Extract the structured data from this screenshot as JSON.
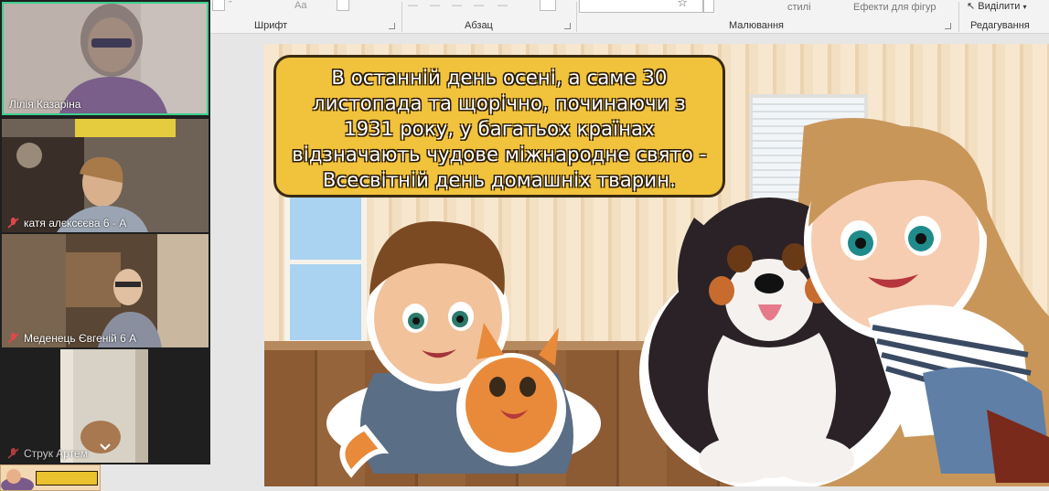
{
  "ribbon": {
    "groups": [
      {
        "label": "Шрифт"
      },
      {
        "label": "Абзац"
      },
      {
        "label": "Малювання"
      },
      {
        "label": "Редагування"
      }
    ],
    "top_items": {
      "styles": "стилі",
      "shape_effects": "Ефекти для фігур",
      "select": "Виділити"
    }
  },
  "slide": {
    "text": "В останній день осені, а саме 30 листопада та щорічно, починаючи з 1931 року, у багатьох країнах відзначають чудове міжнародне свято - Всесвітній день домашніх тварин."
  },
  "participants": [
    {
      "name": "Лілія Казаріна",
      "muted": false,
      "active": true
    },
    {
      "name": "катя алєксєєва 6 - А",
      "muted": true,
      "active": false
    },
    {
      "name": "Меденець Євгеній 6 А",
      "muted": true,
      "active": false
    },
    {
      "name": "Струк Артем",
      "muted": true,
      "active": false
    }
  ],
  "colors": {
    "active_border": "#3ecf8e",
    "textbox_fill": "#f1c23b",
    "panel_bg": "#1f1f1f"
  },
  "icons": {
    "mic_off": "mic-off-icon",
    "chevron": "chevron-down-icon"
  }
}
